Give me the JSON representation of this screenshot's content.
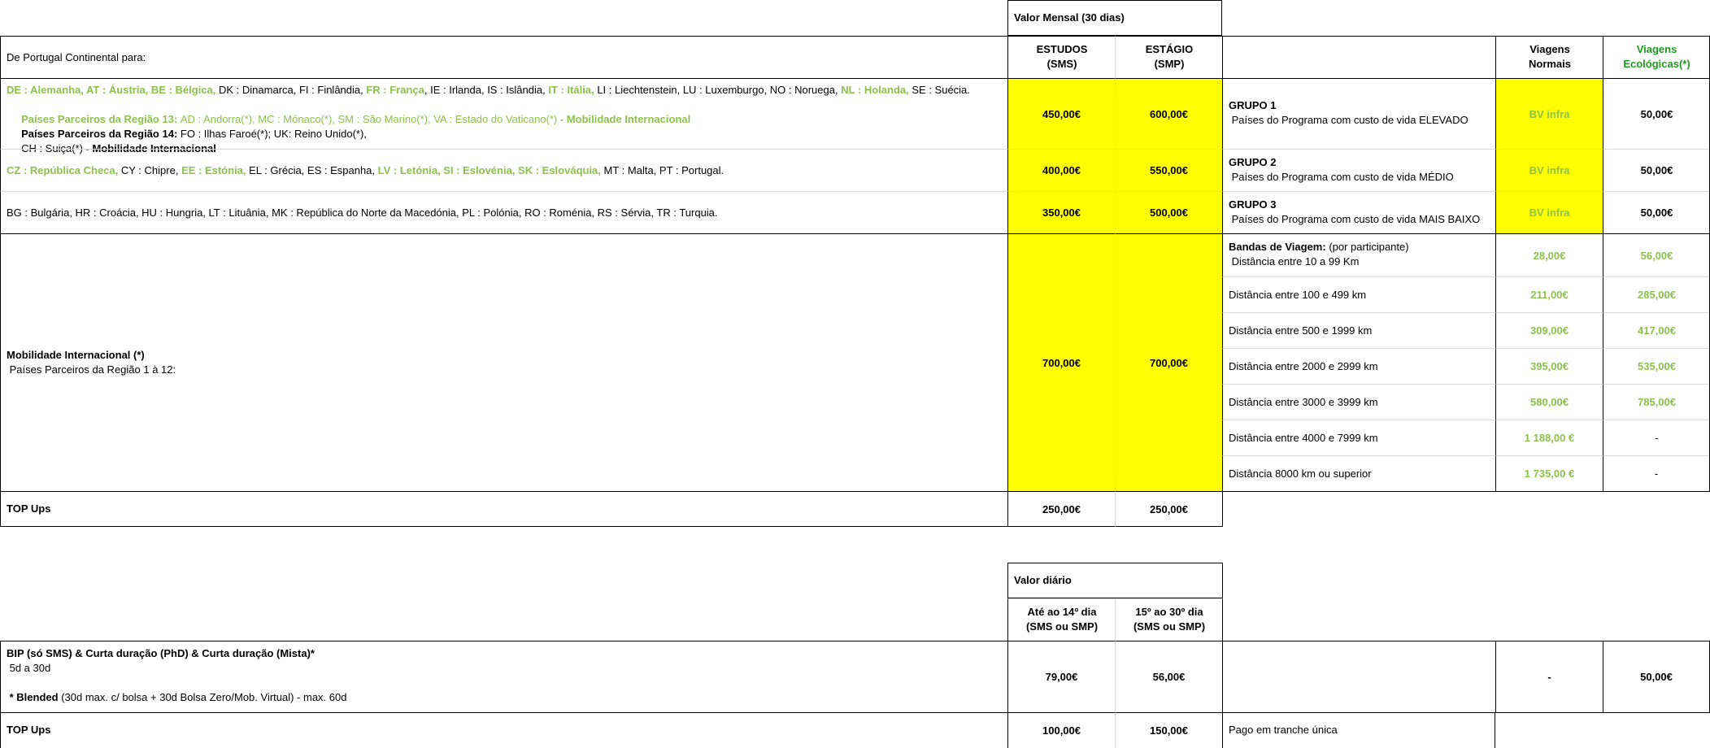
{
  "top": {
    "monthly_header": "Valor Mensal (30 dias)",
    "from_label": "De Portugal Continental para:",
    "col_sms": "ESTUDOS\n(SMS)",
    "col_smp": "ESTÁGIO\n(SMP)",
    "col_normal": "Viagens\nNormais",
    "col_eco": "Viagens\nEcológicas(*)",
    "rows": [
      {
        "countries_line1_parts": [
          {
            "t": "DE : Alemanha, AT : Áustria, BE : Bélgica, ",
            "cls": "gb"
          },
          {
            "t": "DK : Dinamarca, FI : Finlândia, ",
            "cls": ""
          },
          {
            "t": "FR : França",
            "cls": "gb"
          },
          {
            "t": ", IE : Irlanda, IS : Islândia, ",
            "cls": ""
          },
          {
            "t": "IT : Itália, ",
            "cls": "gb"
          },
          {
            "t": "LI : Liechtenstein, LU : Luxemburgo, NO : Noruega, ",
            "cls": ""
          },
          {
            "t": "NL : Holanda, ",
            "cls": "gb"
          },
          {
            "t": "SE : Suécia.",
            "cls": ""
          }
        ],
        "countries_line2_parts": [
          {
            "t": " Países Parceiros da Região 13: ",
            "cls": "gb"
          },
          {
            "t": "AD : Andorra(*), MC : Mónaco(*), SM : São Marino(*), VA : Estado do Vaticano(*)",
            "cls": "g"
          },
          {
            "t": " - Mobilidade Internacional",
            "cls": "gb"
          }
        ],
        "countries_line3_parts": [
          {
            "t": " Países Parceiros da Região 14: ",
            "cls": "b"
          },
          {
            "t": "FO : Ilhas Faroé(*); UK: Reino Unido(*),",
            "cls": ""
          }
        ],
        "countries_line4_parts": [
          {
            "t": " CH : Suiça(*) ",
            "cls": ""
          },
          {
            "t": "- Mobilidade Internacional",
            "cls": "b"
          }
        ],
        "sms": "450,00€",
        "smp": "600,00€",
        "group_title": "GRUPO 1",
        "group_desc": " Países do Programa com custo de vida ELEVADO",
        "normal": "BV infra",
        "eco": "50,00€"
      },
      {
        "countries_line1_parts": [
          {
            "t": "CZ : República Checa, ",
            "cls": "gb"
          },
          {
            "t": "CY : Chipre, ",
            "cls": ""
          },
          {
            "t": "EE : Estónia, ",
            "cls": "gb"
          },
          {
            "t": "EL : Grécia, ES : Espanha, ",
            "cls": ""
          },
          {
            "t": "LV : Letónia, SI : Eslovénia, SK : Eslováquia, ",
            "cls": "gb"
          },
          {
            "t": "MT : Malta, PT : Portugal.",
            "cls": ""
          }
        ],
        "sms": "400,00€",
        "smp": "550,00€",
        "group_title": "GRUPO 2",
        "group_desc": " Países do Programa com custo de vida MÉDIO",
        "normal": "BV infra",
        "eco": "50,00€"
      },
      {
        "countries_text": "BG : Bulgária, HR : Croácia, HU : Hungria, LT : Lituânia, MK : República do Norte da Macedónia, PL : Polónia, RO : Roménia, RS : Sérvia, TR : Turquia.",
        "sms": "350,00€",
        "smp": "500,00€",
        "group_title": "GRUPO 3",
        "group_desc": " Países do Programa com custo de vida MAIS BAIXO",
        "normal": "BV infra",
        "eco": "50,00€"
      }
    ],
    "intl": {
      "title": "Mobilidade Internacional (*)",
      "desc": " Países Parceiros da Região 1 à 12:",
      "sms": "700,00€",
      "smp": "700,00€",
      "bands_title": "Bandas de Viagem:",
      "bands_note": " (por participante)",
      "bands": [
        {
          "label": " Distância entre 10 a 99 Km",
          "normal": "28,00€",
          "eco": "56,00€"
        },
        {
          "label": "Distância entre 100 e 499 km",
          "normal": "211,00€",
          "eco": "285,00€"
        },
        {
          "label": "Distância entre 500 e 1999 km",
          "normal": "309,00€",
          "eco": "417,00€"
        },
        {
          "label": "Distância entre 2000 e 2999 km",
          "normal": "395,00€",
          "eco": "535,00€"
        },
        {
          "label": "Distância entre 3000 e 3999 km",
          "normal": "580,00€",
          "eco": "785,00€"
        },
        {
          "label": "Distância entre 4000 e 7999 km",
          "normal": "1 188,00 €",
          "eco": "-"
        },
        {
          "label": "Distância 8000 km ou superior",
          "normal": "1 735,00 €",
          "eco": "-"
        }
      ]
    },
    "topups": {
      "label": "TOP Ups",
      "sms": "250,00€",
      "smp": "250,00€"
    }
  },
  "bottom": {
    "daily_header": "Valor diário",
    "col_a": "Até ao 14º dia\n(SMS ou SMP)",
    "col_b": "15º ao 30º dia\n(SMS ou SMP)",
    "bip_title": "BIP (só SMS) & Curta duração (PhD) & Curta duração (Mista)*",
    "bip_sub": " 5d a 30d",
    "blended_bold": " * Blended",
    "blended_rest": " (30d max. c/ bolsa + 30d Bolsa Zero/Mob. Virtual) - max. 60d",
    "bip_a": "79,00€",
    "bip_b": "56,00€",
    "bip_normal": "-",
    "bip_eco": "50,00€",
    "topups_label": "TOP Ups",
    "topups_a": "100,00€",
    "topups_b": "150,00€",
    "topups_note": "Pago em tranche única"
  },
  "colors": {
    "highlight": "#ffff00",
    "green": "#8bc34a",
    "dark_green": "#1e9c1e"
  }
}
